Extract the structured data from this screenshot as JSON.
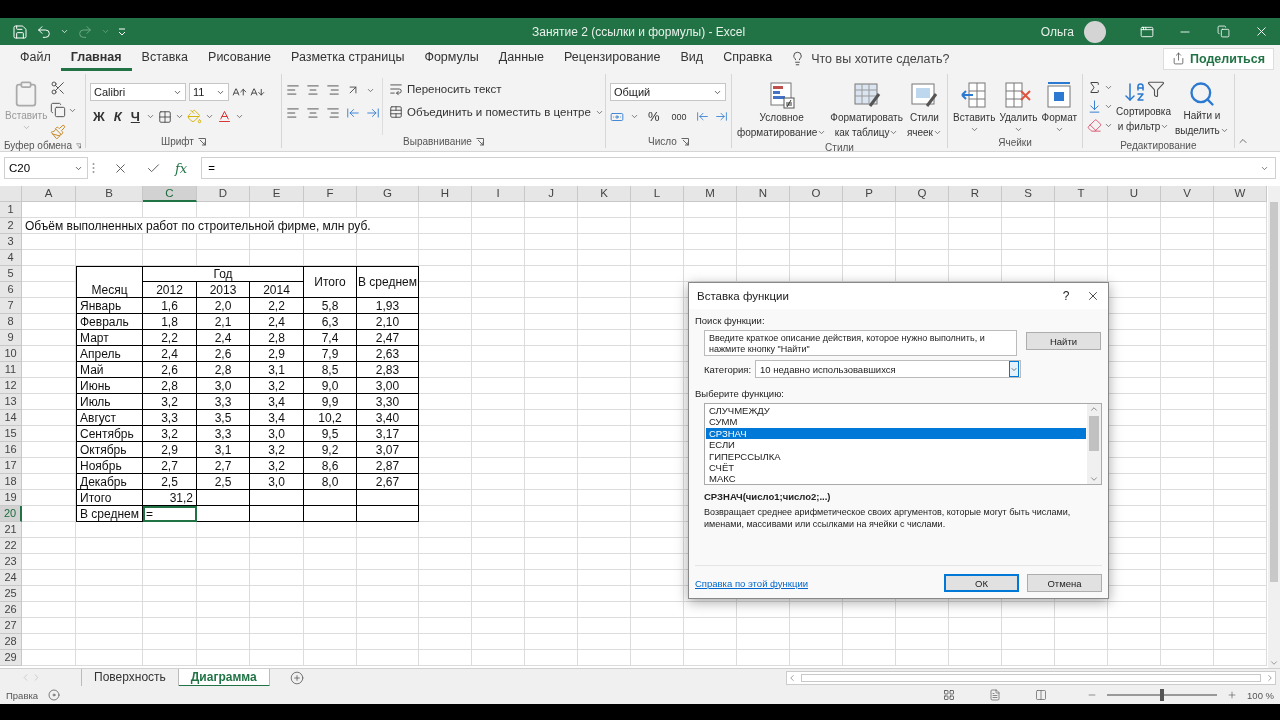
{
  "window": {
    "title": "Занятие 2 (ссылки и формулы)  -  Excel",
    "user": "Ольга"
  },
  "ribbon_tabs": [
    {
      "label": "Файл",
      "selected": false
    },
    {
      "label": "Главная",
      "selected": true
    },
    {
      "label": "Вставка",
      "selected": false
    },
    {
      "label": "Рисование",
      "selected": false
    },
    {
      "label": "Разметка страницы",
      "selected": false
    },
    {
      "label": "Формулы",
      "selected": false
    },
    {
      "label": "Данные",
      "selected": false
    },
    {
      "label": "Рецензирование",
      "selected": false
    },
    {
      "label": "Вид",
      "selected": false
    },
    {
      "label": "Справка",
      "selected": false
    }
  ],
  "tell_me": "Что вы хотите сделать?",
  "share_button": "Поделиться",
  "ribbon": {
    "clipboard": {
      "label": "Буфер обмена",
      "paste": "Вставить"
    },
    "font": {
      "label": "Шрифт",
      "font_name": "Calibri",
      "font_size": "11",
      "bold": "Ж",
      "italic": "К",
      "underline": "Ч"
    },
    "alignment": {
      "label": "Выравнивание",
      "wrap_text": "Переносить текст",
      "merge": "Объединить и поместить в центре"
    },
    "number": {
      "label": "Число",
      "format": "Общий",
      "percent": "%",
      "thousands": "000"
    },
    "styles": {
      "label": "Стили",
      "buttons": [
        {
          "kind": "conditional",
          "lines": [
            "Условное",
            "форматирование"
          ]
        },
        {
          "kind": "table",
          "lines": [
            "Форматировать",
            "как таблицу"
          ]
        },
        {
          "kind": "cellstyles",
          "lines": [
            "Стили",
            "ячеек"
          ]
        }
      ]
    },
    "cells": {
      "label": "Ячейки",
      "buttons": [
        {
          "kind": "insert",
          "lines": [
            "Вставить"
          ]
        },
        {
          "kind": "delete",
          "lines": [
            "Удалить"
          ]
        },
        {
          "kind": "format",
          "lines": [
            "Формат"
          ]
        }
      ]
    },
    "editing": {
      "label": "Редактирование",
      "buttons": [
        {
          "kind": "sort",
          "lines": [
            "Сортировка",
            "и фильтр"
          ]
        },
        {
          "kind": "find",
          "lines": [
            "Найти и",
            "выделить"
          ]
        }
      ]
    }
  },
  "formula_bar": {
    "name_box": "C20",
    "fx": "fx",
    "formula": "="
  },
  "sheet": {
    "columns": [
      {
        "label": "A",
        "selected": false
      },
      {
        "label": "B",
        "selected": false
      },
      {
        "label": "C",
        "selected": true
      },
      {
        "label": "D",
        "selected": false
      },
      {
        "label": "E",
        "selected": false
      },
      {
        "label": "F",
        "selected": false
      },
      {
        "label": "G",
        "selected": false
      },
      {
        "label": "H",
        "selected": false
      },
      {
        "label": "I",
        "selected": false
      },
      {
        "label": "J",
        "selected": false
      },
      {
        "label": "K",
        "selected": false
      },
      {
        "label": "L",
        "selected": false
      },
      {
        "label": "M",
        "selected": false
      },
      {
        "label": "N",
        "selected": false
      },
      {
        "label": "O",
        "selected": false
      },
      {
        "label": "P",
        "selected": false
      },
      {
        "label": "Q",
        "selected": false
      },
      {
        "label": "R",
        "selected": false
      },
      {
        "label": "S",
        "selected": false
      },
      {
        "label": "T",
        "selected": false
      },
      {
        "label": "U",
        "selected": false
      },
      {
        "label": "V",
        "selected": false
      },
      {
        "label": "W",
        "selected": false
      }
    ],
    "rows": [
      {
        "label": "1",
        "selected": false
      },
      {
        "label": "2",
        "selected": false
      },
      {
        "label": "3",
        "selected": false
      },
      {
        "label": "4",
        "selected": false
      },
      {
        "label": "5",
        "selected": false
      },
      {
        "label": "6",
        "selected": false
      },
      {
        "label": "7",
        "selected": false
      },
      {
        "label": "8",
        "selected": false
      },
      {
        "label": "9",
        "selected": false
      },
      {
        "label": "10",
        "selected": false
      },
      {
        "label": "11",
        "selected": false
      },
      {
        "label": "12",
        "selected": false
      },
      {
        "label": "13",
        "selected": false
      },
      {
        "label": "14",
        "selected": false
      },
      {
        "label": "15",
        "selected": false
      },
      {
        "label": "16",
        "selected": false
      },
      {
        "label": "17",
        "selected": false
      },
      {
        "label": "18",
        "selected": false
      },
      {
        "label": "19",
        "selected": false
      },
      {
        "label": "20",
        "selected": true
      },
      {
        "label": "21",
        "selected": false
      },
      {
        "label": "22",
        "selected": false
      },
      {
        "label": "23",
        "selected": false
      },
      {
        "label": "24",
        "selected": false
      },
      {
        "label": "25",
        "selected": false
      },
      {
        "label": "26",
        "selected": false
      },
      {
        "label": "27",
        "selected": false
      },
      {
        "label": "28",
        "selected": false
      },
      {
        "label": "29",
        "selected": false
      }
    ],
    "title": "Объём выполненных работ по строительной фирме, млн руб.",
    "table": {
      "month_header": "Месяц",
      "year_header": "Год",
      "years": [
        "2012",
        "2013",
        "2014"
      ],
      "total_header": "Итого",
      "average_header": "В среднем",
      "rows": [
        {
          "month": "Январь",
          "values": [
            "1,6",
            "2,0",
            "2,2"
          ],
          "total": "5,8",
          "average": "1,93"
        },
        {
          "month": "Февраль",
          "values": [
            "1,8",
            "2,1",
            "2,4"
          ],
          "total": "6,3",
          "average": "2,10"
        },
        {
          "month": "Март",
          "values": [
            "2,2",
            "2,4",
            "2,8"
          ],
          "total": "7,4",
          "average": "2,47"
        },
        {
          "month": "Апрель",
          "values": [
            "2,4",
            "2,6",
            "2,9"
          ],
          "total": "7,9",
          "average": "2,63"
        },
        {
          "month": "Май",
          "values": [
            "2,6",
            "2,8",
            "3,1"
          ],
          "total": "8,5",
          "average": "2,83"
        },
        {
          "month": "Июнь",
          "values": [
            "2,8",
            "3,0",
            "3,2"
          ],
          "total": "9,0",
          "average": "3,00"
        },
        {
          "month": "Июль",
          "values": [
            "3,2",
            "3,3",
            "3,4"
          ],
          "total": "9,9",
          "average": "3,30"
        },
        {
          "month": "Август",
          "values": [
            "3,3",
            "3,5",
            "3,4"
          ],
          "total": "10,2",
          "average": "3,40"
        },
        {
          "month": "Сентябрь",
          "values": [
            "3,2",
            "3,3",
            "3,0"
          ],
          "total": "9,5",
          "average": "3,17"
        },
        {
          "month": "Октябрь",
          "values": [
            "2,9",
            "3,1",
            "3,2"
          ],
          "total": "9,2",
          "average": "3,07"
        },
        {
          "month": "Ноябрь",
          "values": [
            "2,7",
            "2,7",
            "3,2"
          ],
          "total": "8,6",
          "average": "2,87"
        },
        {
          "month": "Декабрь",
          "values": [
            "2,5",
            "2,5",
            "3,0"
          ],
          "total": "8,0",
          "average": "2,67"
        }
      ],
      "summary": [
        {
          "label": "Итого",
          "value": "31,2",
          "selected": false
        },
        {
          "label": "В среднем",
          "value": "=",
          "selected": true
        }
      ]
    }
  },
  "dialog": {
    "title": "Вставка функции",
    "help": "?",
    "search_label": "Поиск функции:",
    "search_value": "Введите краткое описание действия, которое нужно выполнить, и нажмите кнопку \"Найти\"",
    "find_button": "Найти",
    "category_label": "Категория:",
    "category": "10 недавно использовавшихся",
    "list_label": "Выберите функцию:",
    "functions": [
      {
        "name": "СЛУЧМЕЖДУ",
        "selected": false
      },
      {
        "name": "СУММ",
        "selected": false
      },
      {
        "name": "СРЗНАЧ",
        "selected": true
      },
      {
        "name": "ЕСЛИ",
        "selected": false
      },
      {
        "name": "ГИПЕРССЫЛКА",
        "selected": false
      },
      {
        "name": "СЧЁТ",
        "selected": false
      },
      {
        "name": "МАКС",
        "selected": false
      }
    ],
    "signature": "СРЗНАЧ(число1;число2;...)",
    "description": "Возвращает среднее арифметическое своих аргументов, которые могут быть числами, именами, массивами или ссылками на ячейки с числами.",
    "help_link": "Справка по этой функции",
    "ok_button": "ОК",
    "cancel_button": "Отмена"
  },
  "sheet_tabs": [
    {
      "label": "Поверхность",
      "selected": false
    },
    {
      "label": "Диаграмма",
      "selected": true
    }
  ],
  "status_bar": {
    "mode": "Правка",
    "zoom": "100 %",
    "zoom_slider": {
      "level": 0.5
    }
  }
}
